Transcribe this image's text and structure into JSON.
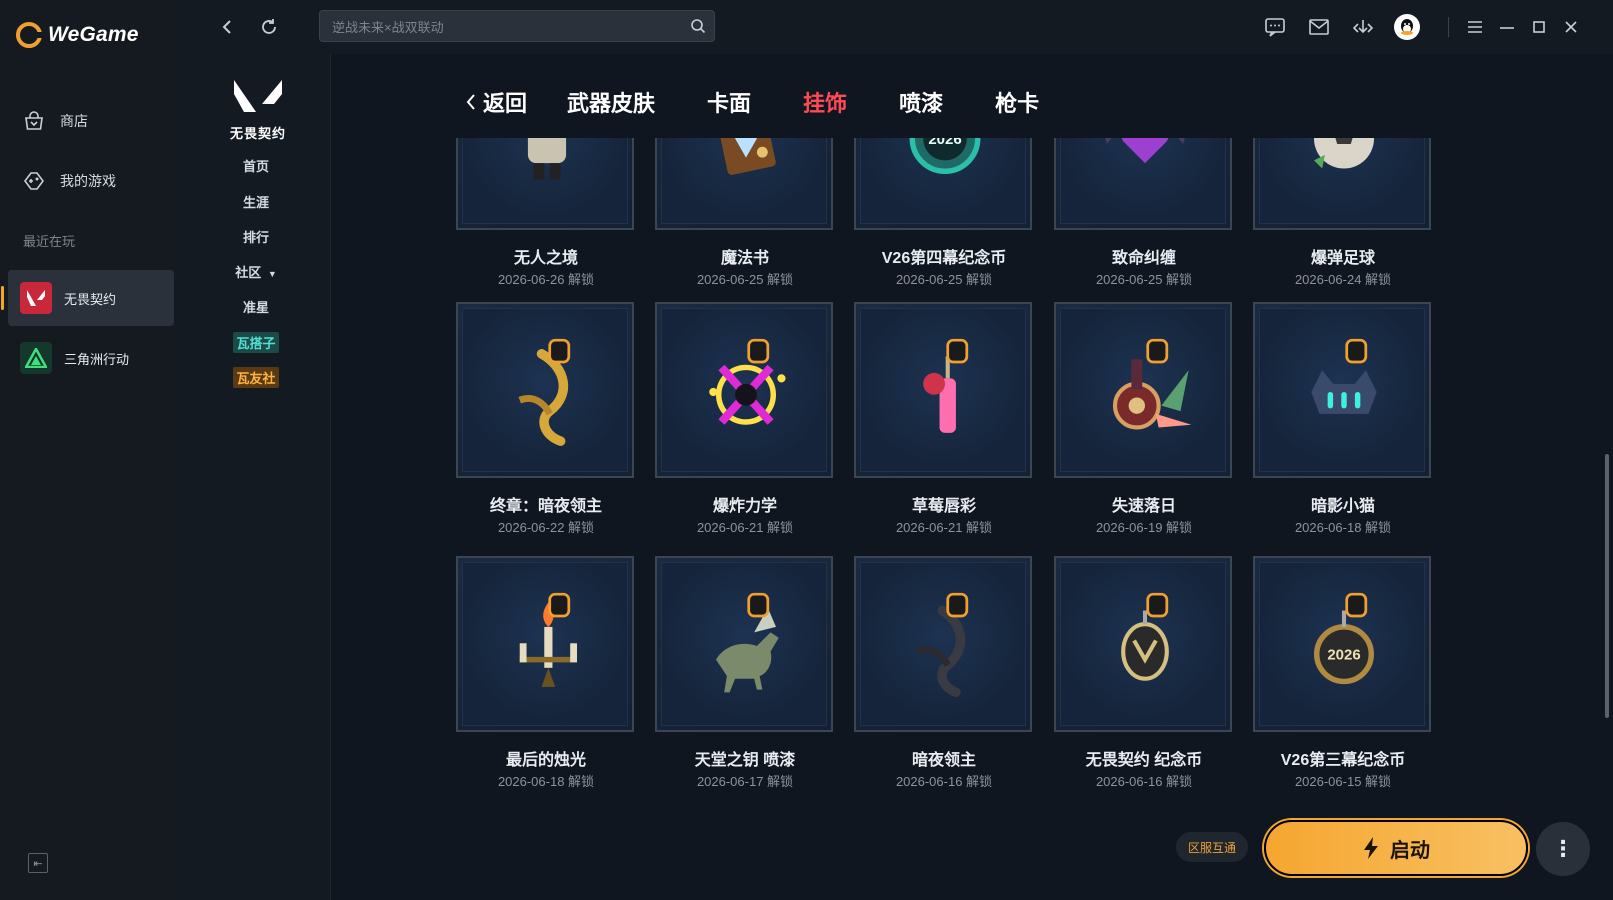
{
  "app": {
    "brand": "WeGame"
  },
  "sidebar": {
    "items": [
      {
        "label": "商店",
        "icon": "store-bag-icon"
      },
      {
        "label": "我的游戏",
        "icon": "my-games-icon"
      }
    ],
    "recent_label": "最近在玩",
    "recent_games": [
      {
        "label": "无畏契约",
        "icon": "valorant-icon",
        "active": true
      },
      {
        "label": "三角洲行动",
        "icon": "delta-force-icon",
        "active": false
      }
    ]
  },
  "topbar": {
    "search_placeholder": "逆战未来×战双联动",
    "icons": [
      "back-icon",
      "refresh-icon",
      "search-icon",
      "chat-icon",
      "mail-icon",
      "download-icon",
      "avatar-icon",
      "menu-icon",
      "minimize-icon",
      "maximize-icon",
      "close-icon"
    ]
  },
  "game_nav": {
    "game_name": "无畏契约",
    "items": [
      "首页",
      "生涯",
      "排行",
      "社区",
      "准星"
    ],
    "badges": [
      {
        "label": "瓦搭子",
        "color": "#3ec8b8"
      },
      {
        "label": "瓦友社",
        "color": "#f0a030"
      }
    ]
  },
  "tabs": {
    "back_label": "返回",
    "items": [
      {
        "label": "武器皮肤",
        "active": false
      },
      {
        "label": "卡面",
        "active": false
      },
      {
        "label": "挂饰",
        "active": true
      },
      {
        "label": "喷漆",
        "active": false
      },
      {
        "label": "枪卡",
        "active": false
      }
    ]
  },
  "items": [
    {
      "name": "无人之境",
      "date": "2026-06-26 解锁",
      "icon": "figure-charm-icon"
    },
    {
      "name": "魔法书",
      "date": "2026-06-25 解锁",
      "icon": "magic-book-charm-icon"
    },
    {
      "name": "V26第四幕纪念币",
      "date": "2026-06-25 解锁",
      "icon": "coin-charm-icon"
    },
    {
      "name": "致命纠缠",
      "date": "2026-06-25 解锁",
      "icon": "heart-wing-charm-icon"
    },
    {
      "name": "爆弹足球",
      "date": "2026-06-24 解锁",
      "icon": "soccer-ball-charm-icon"
    },
    {
      "name": "终章：暗夜领主",
      "date": "2026-06-22 解锁",
      "icon": "gold-dragon-charm-icon"
    },
    {
      "name": "爆炸力学",
      "date": "2026-06-21 解锁",
      "icon": "explosion-charm-icon"
    },
    {
      "name": "草莓唇彩",
      "date": "2026-06-21 解锁",
      "icon": "lip-gloss-charm-icon"
    },
    {
      "name": "失速落日",
      "date": "2026-06-19 解锁",
      "icon": "sunset-wheel-charm-icon"
    },
    {
      "name": "暗影小猫",
      "date": "2026-06-18 解锁",
      "icon": "shadow-cat-charm-icon"
    },
    {
      "name": "最后的烛光",
      "date": "2026-06-18 解锁",
      "icon": "candle-charm-icon"
    },
    {
      "name": "天堂之钥 喷漆",
      "date": "2026-06-17 解锁",
      "icon": "pegasus-charm-icon"
    },
    {
      "name": "暗夜领主",
      "date": "2026-06-16 解锁",
      "icon": "dark-dragon-charm-icon"
    },
    {
      "name": "无畏契约 纪念币",
      "date": "2026-06-16 解锁",
      "icon": "valorant-coin-charm-icon"
    },
    {
      "name": "V26第三幕纪念币",
      "date": "2026-06-15 解锁",
      "icon": "coin-2026-charm-icon"
    }
  ],
  "actions": {
    "region_label": "区服互通",
    "launch_label": "启动",
    "more_label": "⋮"
  },
  "colors": {
    "accent": "#f5a623",
    "active_tab": "#ff4a55",
    "background": "#0f1620"
  }
}
